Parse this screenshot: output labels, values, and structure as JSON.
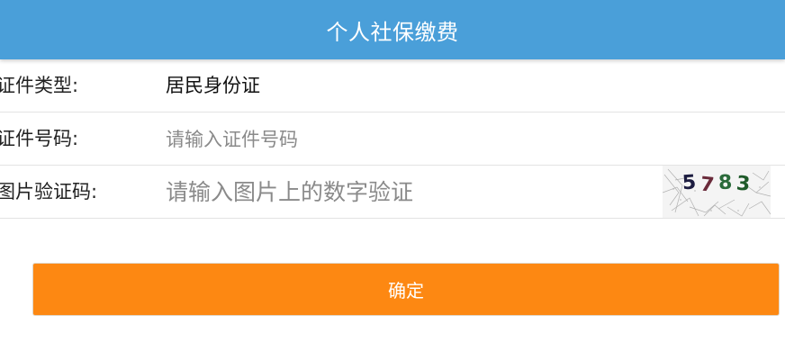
{
  "header": {
    "title": "个人社保缴费"
  },
  "form": {
    "id_type": {
      "label": "证件类型:",
      "value": "居民身份证"
    },
    "id_number": {
      "label": "证件号码:",
      "placeholder": "请输入证件号码",
      "value": ""
    },
    "captcha": {
      "label": "图片验证码:",
      "placeholder": "请输入图片上的数字验证",
      "value": "",
      "digits": [
        "5",
        "7",
        "8",
        "3"
      ],
      "digit_colors": [
        "#1c1c40",
        "#6a2a3a",
        "#2a6a3a",
        "#1f5a2a"
      ]
    }
  },
  "actions": {
    "confirm_label": "确定",
    "confirm_color": "#fd8812"
  },
  "colors": {
    "header_bg": "#4a9fd9",
    "header_text": "#ffffff",
    "placeholder": "#8a8a8a"
  }
}
